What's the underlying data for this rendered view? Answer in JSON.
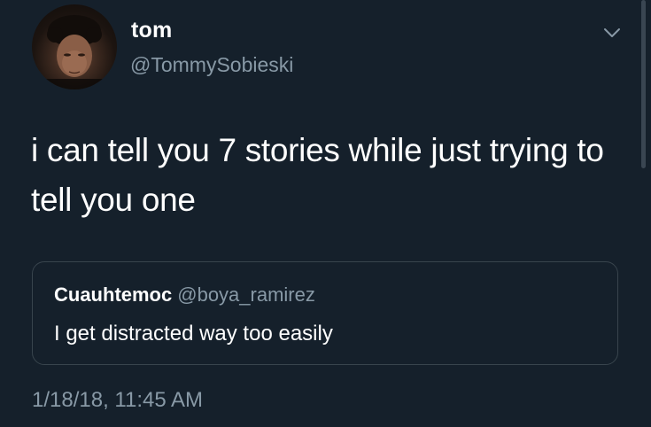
{
  "author": {
    "display_name": "tom",
    "handle": "@TommySobieski",
    "avatar_icon": "profile-photo"
  },
  "tweet": {
    "text": "i can tell you 7 stories while just trying to tell you one",
    "timestamp": "1/18/18, 11:45 AM"
  },
  "quoted_tweet": {
    "display_name": "Cuauhtemoc",
    "handle": "@boya_ramirez",
    "text": "I get distracted way too easily"
  },
  "menu": {
    "caret_icon": "chevron-down-icon"
  },
  "colors": {
    "background": "#15202b",
    "text_primary": "#ffffff",
    "text_secondary": "#8899a6",
    "border": "#38444d"
  }
}
